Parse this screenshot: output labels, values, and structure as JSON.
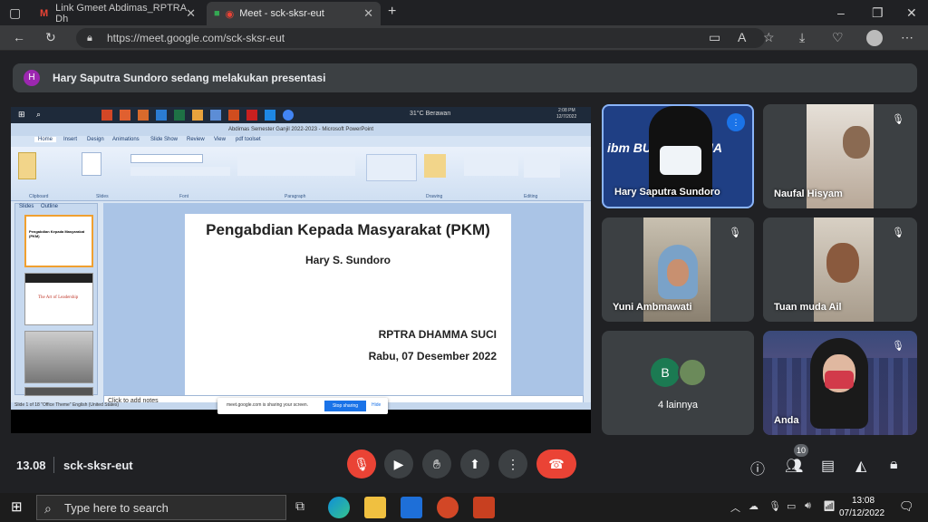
{
  "browser": {
    "tabs": [
      {
        "title": "Link Gmeet Abdimas_RPTRA Dh"
      },
      {
        "title": "Meet - sck-sksr-eut"
      }
    ],
    "url": "https://meet.google.com/sck-sksr-eut",
    "new_tab": "+"
  },
  "banner": {
    "avatar_letter": "H",
    "text": "Hary Saputra Sundoro sedang melakukan presentasi"
  },
  "presentation": {
    "windows_taskbar": {
      "weather": "31°C  Berawan",
      "time": "2:08 PM",
      "date": "12/7/2022"
    },
    "ppt_title": "Abdimas Semester Ganjil 2022-2023 - Microsoft PowerPoint",
    "ribbon_tabs": [
      "Home",
      "Insert",
      "Design",
      "Animations",
      "Slide Show",
      "Review",
      "View",
      "pdf toolset"
    ],
    "ribbon_groups": [
      "Clipboard",
      "Slides",
      "Font",
      "Paragraph",
      "Drawing",
      "Editing"
    ],
    "pane_tabs": [
      "Slides",
      "Outline"
    ],
    "thumb_title": "Pengabdian Kepada Masyarakat (PKM)",
    "thumb_slide2": "The Art of Leadership",
    "slide": {
      "title": "Pengabdian Kepada Masyarakat (PKM)",
      "author": "Hary S. Sundoro",
      "org": "RPTRA DHAMMA SUCI",
      "date": "Rabu, 07 Desember 2022"
    },
    "notes_placeholder": "Click to add notes",
    "status": "Slide 1 of 18   \"Office Theme\"   English (United States)",
    "share_notice": "meet.google.com is sharing your screen.",
    "stop_sharing": "Stop sharing",
    "hide": "Hide"
  },
  "participants": [
    {
      "name": "Hary Saputra Sundoro",
      "bg_text": "ibm  BUNDA MULIA"
    },
    {
      "name": "Naufal Hisyam"
    },
    {
      "name": "Yuni Ambmawati"
    },
    {
      "name": "Tuan muda Ail"
    },
    {
      "name": "4 lainnya",
      "avatar_letter": "B"
    },
    {
      "name": "Anda"
    }
  ],
  "meeting": {
    "time": "13.08",
    "code": "sck-sksr-eut",
    "participant_count": "10"
  },
  "taskbar": {
    "search_placeholder": "Type here to search",
    "time": "13:08",
    "date": "07/12/2022"
  },
  "colors": {
    "end_call": "#ea4335",
    "mic_off": "#ea4335",
    "active_border": "#8ab4f8"
  }
}
